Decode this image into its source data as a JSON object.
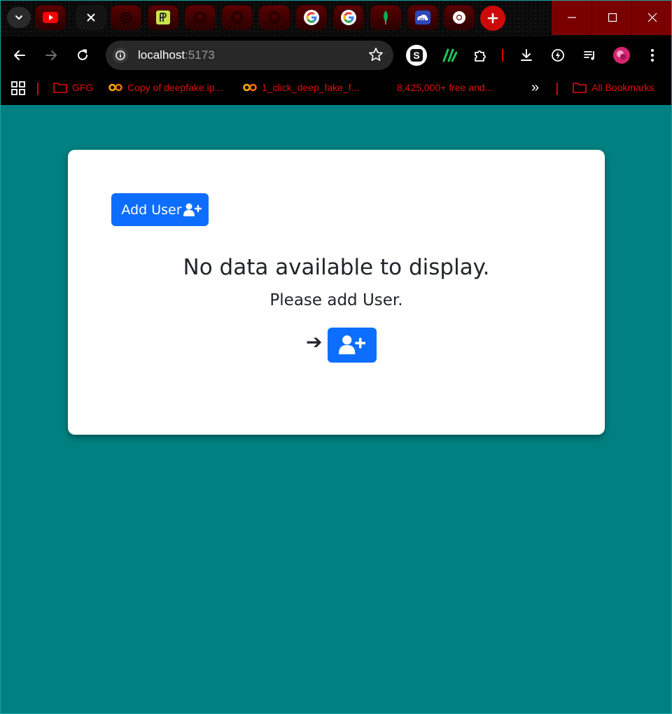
{
  "browser": {
    "tabs": [
      {
        "icon": "youtube-icon"
      },
      {
        "icon": "close-icon",
        "active": true
      },
      {
        "icon": "chatgpt-icon"
      },
      {
        "icon": "pp-icon"
      },
      {
        "icon": "github-icon"
      },
      {
        "icon": "github-icon"
      },
      {
        "icon": "github-icon"
      },
      {
        "icon": "google-icon"
      },
      {
        "icon": "google-icon"
      },
      {
        "icon": "mongodb-icon"
      },
      {
        "icon": "cloud-icon"
      },
      {
        "icon": "chrome-icon"
      }
    ],
    "address": {
      "host": "localhost",
      "port": ":5173"
    },
    "bookmarks": [
      {
        "icon": "folder-icon",
        "label": "GFG"
      },
      {
        "icon": "colab-icon",
        "label": "Copy of deepfake.ip..."
      },
      {
        "icon": "colab-icon",
        "label": "1_click_deep_fake_f..."
      },
      {
        "icon": "",
        "label": "8,425,000+ free and..."
      }
    ],
    "overflow_label": "»",
    "all_bookmarks": "All Bookmarks",
    "colors": {
      "accent": "#e00e0e",
      "frame": "#7a0000"
    }
  },
  "page": {
    "background": "#008080",
    "add_button_label": "Add User",
    "empty_title": "No data available to display.",
    "empty_subtitle": "Please add User.",
    "arrow": "➔",
    "primary_color": "#0d6efd"
  }
}
